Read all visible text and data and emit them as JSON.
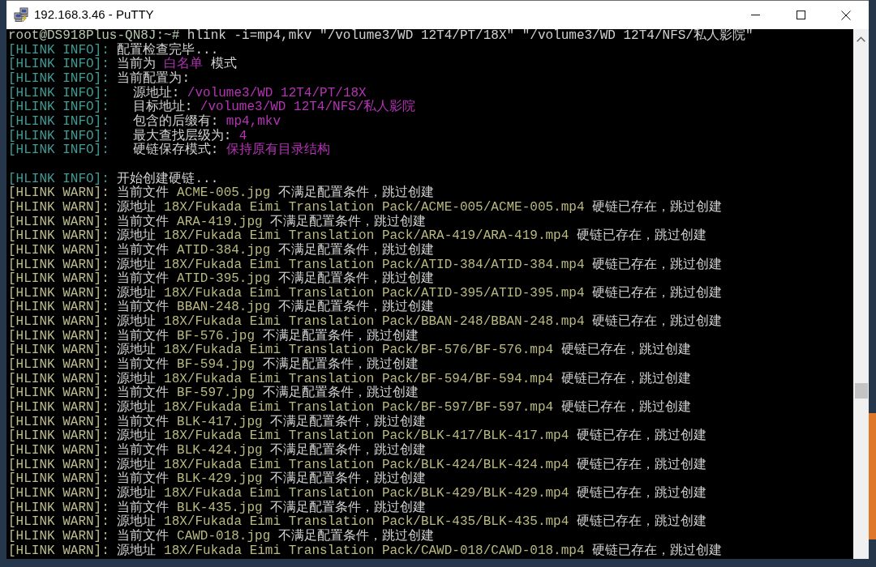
{
  "window": {
    "title": "192.168.3.46 - PuTTY"
  },
  "terminal": {
    "lines": [
      {
        "kind": "command",
        "prompt": "root@DS918Plus-QN8J:~#",
        "command": "hlink -i=mp4,mkv \"/volume3/WD 12T4/PT/18X\" \"/volume3/WD 12T4/NFS/私人影院\""
      },
      {
        "kind": "info",
        "tag": "[HLINK INFO]:",
        "segments": [
          {
            "kind": "text",
            "text": "配置检查完毕..."
          }
        ]
      },
      {
        "kind": "info",
        "tag": "[HLINK INFO]:",
        "segments": [
          {
            "kind": "text",
            "text": "当前为"
          },
          {
            "kind": "value",
            "text": "白名单"
          },
          {
            "kind": "text",
            "text": "模式"
          }
        ]
      },
      {
        "kind": "info",
        "tag": "[HLINK INFO]:",
        "segments": [
          {
            "kind": "text",
            "text": "当前配置为:"
          }
        ],
        "children": [
          {
            "kind": "info",
            "tag": "[HLINK INFO]:",
            "segments": [
              {
                "kind": "text",
                "text": "源地址:"
              },
              {
                "kind": "value",
                "text": "/volume3/WD 12T4/PT/18X"
              }
            ]
          },
          {
            "kind": "info",
            "tag": "[HLINK INFO]:",
            "segments": [
              {
                "kind": "text",
                "text": "目标地址:"
              },
              {
                "kind": "value",
                "text": "/volume3/WD 12T4/NFS/私人影院"
              }
            ]
          },
          {
            "kind": "info",
            "tag": "[HLINK INFO]:",
            "segments": [
              {
                "kind": "text",
                "text": "包含的后缀有:"
              },
              {
                "kind": "value",
                "text": "mp4,mkv"
              }
            ]
          },
          {
            "kind": "info",
            "tag": "[HLINK INFO]:",
            "segments": [
              {
                "kind": "text",
                "text": "最大查找层级为:"
              },
              {
                "kind": "value",
                "text": "4"
              }
            ]
          },
          {
            "kind": "info",
            "tag": "[HLINK INFO]:",
            "segments": [
              {
                "kind": "text",
                "text": "硬链保存模式:"
              },
              {
                "kind": "value",
                "text": "保持原有目录结构"
              }
            ]
          }
        ]
      },
      {
        "kind": "blank"
      },
      {
        "kind": "info",
        "tag": "[HLINK INFO]:",
        "segments": [
          {
            "kind": "text",
            "text": "开始创建硬链..."
          }
        ]
      },
      {
        "kind": "warn",
        "tag": "[HLINK WARN]:",
        "segments": [
          {
            "kind": "text",
            "text": "当前文件"
          },
          {
            "kind": "path",
            "text": "ACME-005.jpg"
          },
          {
            "kind": "text",
            "text": "不满足配置条件，跳过创建"
          }
        ]
      },
      {
        "kind": "warn",
        "tag": "[HLINK WARN]:",
        "segments": [
          {
            "kind": "text",
            "text": "源地址"
          },
          {
            "kind": "path",
            "text": "18X/Fukada Eimi Translation Pack/ACME-005/ACME-005.mp4"
          },
          {
            "kind": "text",
            "text": "硬链已存在，跳过创建"
          }
        ]
      },
      {
        "kind": "warn",
        "tag": "[HLINK WARN]:",
        "segments": [
          {
            "kind": "text",
            "text": "当前文件"
          },
          {
            "kind": "path",
            "text": "ARA-419.jpg"
          },
          {
            "kind": "text",
            "text": "不满足配置条件，跳过创建"
          }
        ]
      },
      {
        "kind": "warn",
        "tag": "[HLINK WARN]:",
        "segments": [
          {
            "kind": "text",
            "text": "源地址"
          },
          {
            "kind": "path",
            "text": "18X/Fukada Eimi Translation Pack/ARA-419/ARA-419.mp4"
          },
          {
            "kind": "text",
            "text": "硬链已存在，跳过创建"
          }
        ]
      },
      {
        "kind": "warn",
        "tag": "[HLINK WARN]:",
        "segments": [
          {
            "kind": "text",
            "text": "当前文件"
          },
          {
            "kind": "path",
            "text": "ATID-384.jpg"
          },
          {
            "kind": "text",
            "text": "不满足配置条件，跳过创建"
          }
        ]
      },
      {
        "kind": "warn",
        "tag": "[HLINK WARN]:",
        "segments": [
          {
            "kind": "text",
            "text": "源地址"
          },
          {
            "kind": "path",
            "text": "18X/Fukada Eimi Translation Pack/ATID-384/ATID-384.mp4"
          },
          {
            "kind": "text",
            "text": "硬链已存在，跳过创建"
          }
        ]
      },
      {
        "kind": "warn",
        "tag": "[HLINK WARN]:",
        "segments": [
          {
            "kind": "text",
            "text": "当前文件"
          },
          {
            "kind": "path",
            "text": "ATID-395.jpg"
          },
          {
            "kind": "text",
            "text": "不满足配置条件，跳过创建"
          }
        ]
      },
      {
        "kind": "warn",
        "tag": "[HLINK WARN]:",
        "segments": [
          {
            "kind": "text",
            "text": "源地址"
          },
          {
            "kind": "path",
            "text": "18X/Fukada Eimi Translation Pack/ATID-395/ATID-395.mp4"
          },
          {
            "kind": "text",
            "text": "硬链已存在，跳过创建"
          }
        ]
      },
      {
        "kind": "warn",
        "tag": "[HLINK WARN]:",
        "segments": [
          {
            "kind": "text",
            "text": "当前文件"
          },
          {
            "kind": "path",
            "text": "BBAN-248.jpg"
          },
          {
            "kind": "text",
            "text": "不满足配置条件，跳过创建"
          }
        ]
      },
      {
        "kind": "warn",
        "tag": "[HLINK WARN]:",
        "segments": [
          {
            "kind": "text",
            "text": "源地址"
          },
          {
            "kind": "path",
            "text": "18X/Fukada Eimi Translation Pack/BBAN-248/BBAN-248.mp4"
          },
          {
            "kind": "text",
            "text": "硬链已存在，跳过创建"
          }
        ]
      },
      {
        "kind": "warn",
        "tag": "[HLINK WARN]:",
        "segments": [
          {
            "kind": "text",
            "text": "当前文件"
          },
          {
            "kind": "path",
            "text": "BF-576.jpg"
          },
          {
            "kind": "text",
            "text": "不满足配置条件，跳过创建"
          }
        ]
      },
      {
        "kind": "warn",
        "tag": "[HLINK WARN]:",
        "segments": [
          {
            "kind": "text",
            "text": "源地址"
          },
          {
            "kind": "path",
            "text": "18X/Fukada Eimi Translation Pack/BF-576/BF-576.mp4"
          },
          {
            "kind": "text",
            "text": "硬链已存在，跳过创建"
          }
        ]
      },
      {
        "kind": "warn",
        "tag": "[HLINK WARN]:",
        "segments": [
          {
            "kind": "text",
            "text": "当前文件"
          },
          {
            "kind": "path",
            "text": "BF-594.jpg"
          },
          {
            "kind": "text",
            "text": "不满足配置条件，跳过创建"
          }
        ]
      },
      {
        "kind": "warn",
        "tag": "[HLINK WARN]:",
        "segments": [
          {
            "kind": "text",
            "text": "源地址"
          },
          {
            "kind": "path",
            "text": "18X/Fukada Eimi Translation Pack/BF-594/BF-594.mp4"
          },
          {
            "kind": "text",
            "text": "硬链已存在，跳过创建"
          }
        ]
      },
      {
        "kind": "warn",
        "tag": "[HLINK WARN]:",
        "segments": [
          {
            "kind": "text",
            "text": "当前文件"
          },
          {
            "kind": "path",
            "text": "BF-597.jpg"
          },
          {
            "kind": "text",
            "text": "不满足配置条件，跳过创建"
          }
        ]
      },
      {
        "kind": "warn",
        "tag": "[HLINK WARN]:",
        "segments": [
          {
            "kind": "text",
            "text": "源地址"
          },
          {
            "kind": "path",
            "text": "18X/Fukada Eimi Translation Pack/BF-597/BF-597.mp4"
          },
          {
            "kind": "text",
            "text": "硬链已存在，跳过创建"
          }
        ]
      },
      {
        "kind": "warn",
        "tag": "[HLINK WARN]:",
        "segments": [
          {
            "kind": "text",
            "text": "当前文件"
          },
          {
            "kind": "path",
            "text": "BLK-417.jpg"
          },
          {
            "kind": "text",
            "text": "不满足配置条件，跳过创建"
          }
        ]
      },
      {
        "kind": "warn",
        "tag": "[HLINK WARN]:",
        "segments": [
          {
            "kind": "text",
            "text": "源地址"
          },
          {
            "kind": "path",
            "text": "18X/Fukada Eimi Translation Pack/BLK-417/BLK-417.mp4"
          },
          {
            "kind": "text",
            "text": "硬链已存在，跳过创建"
          }
        ]
      },
      {
        "kind": "warn",
        "tag": "[HLINK WARN]:",
        "segments": [
          {
            "kind": "text",
            "text": "当前文件"
          },
          {
            "kind": "path",
            "text": "BLK-424.jpg"
          },
          {
            "kind": "text",
            "text": "不满足配置条件，跳过创建"
          }
        ]
      },
      {
        "kind": "warn",
        "tag": "[HLINK WARN]:",
        "segments": [
          {
            "kind": "text",
            "text": "源地址"
          },
          {
            "kind": "path",
            "text": "18X/Fukada Eimi Translation Pack/BLK-424/BLK-424.mp4"
          },
          {
            "kind": "text",
            "text": "硬链已存在，跳过创建"
          }
        ]
      },
      {
        "kind": "warn",
        "tag": "[HLINK WARN]:",
        "segments": [
          {
            "kind": "text",
            "text": "当前文件"
          },
          {
            "kind": "path",
            "text": "BLK-429.jpg"
          },
          {
            "kind": "text",
            "text": "不满足配置条件，跳过创建"
          }
        ]
      },
      {
        "kind": "warn",
        "tag": "[HLINK WARN]:",
        "segments": [
          {
            "kind": "text",
            "text": "源地址"
          },
          {
            "kind": "path",
            "text": "18X/Fukada Eimi Translation Pack/BLK-429/BLK-429.mp4"
          },
          {
            "kind": "text",
            "text": "硬链已存在，跳过创建"
          }
        ]
      },
      {
        "kind": "warn",
        "tag": "[HLINK WARN]:",
        "segments": [
          {
            "kind": "text",
            "text": "当前文件"
          },
          {
            "kind": "path",
            "text": "BLK-435.jpg"
          },
          {
            "kind": "text",
            "text": "不满足配置条件，跳过创建"
          }
        ]
      },
      {
        "kind": "warn",
        "tag": "[HLINK WARN]:",
        "segments": [
          {
            "kind": "text",
            "text": "源地址"
          },
          {
            "kind": "path",
            "text": "18X/Fukada Eimi Translation Pack/BLK-435/BLK-435.mp4"
          },
          {
            "kind": "text",
            "text": "硬链已存在，跳过创建"
          }
        ]
      },
      {
        "kind": "warn",
        "tag": "[HLINK WARN]:",
        "segments": [
          {
            "kind": "text",
            "text": "当前文件"
          },
          {
            "kind": "path",
            "text": "CAWD-018.jpg"
          },
          {
            "kind": "text",
            "text": "不满足配置条件，跳过创建"
          }
        ]
      },
      {
        "kind": "warn",
        "tag": "[HLINK WARN]:",
        "segments": [
          {
            "kind": "text",
            "text": "源地址"
          },
          {
            "kind": "path",
            "text": "18X/Fukada Eimi Translation Pack/CAWD-018/CAWD-018.mp4"
          },
          {
            "kind": "text",
            "text": "硬链已存在，跳过创建"
          }
        ]
      }
    ]
  }
}
